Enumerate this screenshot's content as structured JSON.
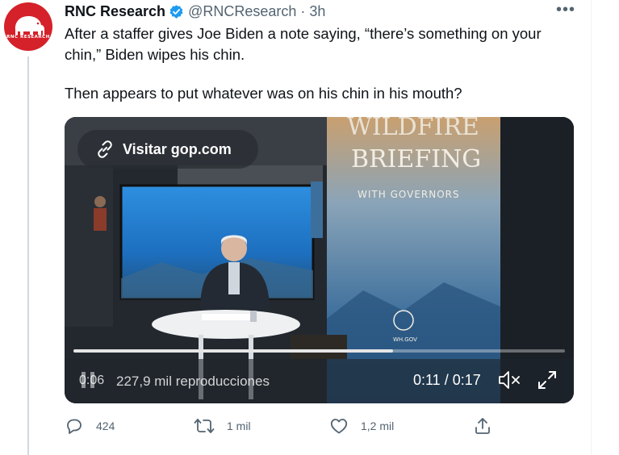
{
  "tweet": {
    "display_name": "RNC Research",
    "handle": "@RNCResearch",
    "separator": "·",
    "time": "3h",
    "more_label": "•••",
    "avatar_text": "RNC RESEARCH",
    "text_line_1": "After a staffer gives Joe Biden a note saying, “there’s something on your chin,” Biden wipes his chin.",
    "text_line_2": "Then appears to put whatever was on his chin in his mouth?"
  },
  "video": {
    "visit_label": "Visitar gop.com",
    "sign_line_1": "WILDFIRE",
    "sign_line_2": "BRIEFING",
    "sign_line_3": "WITH GOVERNORS",
    "sign_logo_text": "WH.GOV",
    "elapsed_left": "0:06",
    "views": "227,9 mil reproducciones",
    "time_display": "0:11 / 0:17",
    "progress_fraction": 0.65
  },
  "actions": {
    "reply_count": "424",
    "retweet_count": "1 mil",
    "like_count": "1,2 mil"
  },
  "colors": {
    "text": "#0f1419",
    "secondary": "#536471",
    "verified": "#1d9bf0",
    "avatar_red": "#d4212a"
  },
  "icons": [
    "verified-badge-icon",
    "more-icon",
    "link-icon",
    "pause-icon",
    "mute-icon",
    "fullscreen-icon",
    "reply-icon",
    "retweet-icon",
    "like-icon",
    "share-icon"
  ]
}
